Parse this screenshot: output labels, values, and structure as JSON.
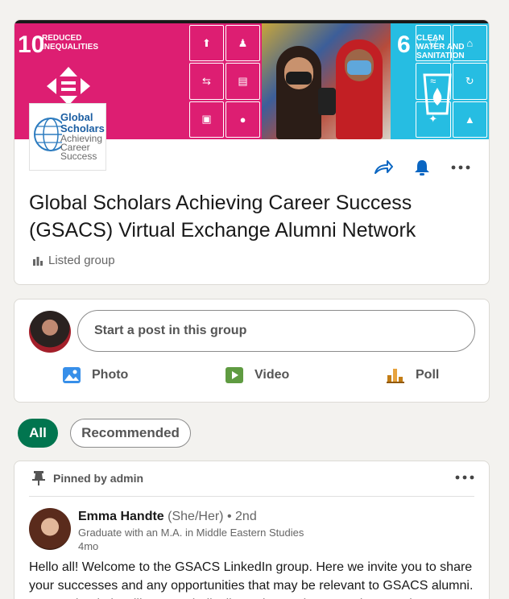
{
  "banner": {
    "sdg10_number": "10",
    "sdg10_text": "REDUCED INEQUALITIES",
    "sdg6_number": "6",
    "sdg6_text": "CLEAN WATER AND SANITATION"
  },
  "logo": {
    "line1": "Global",
    "line2": "Scholars",
    "line3": "Achieving",
    "line4": "Career",
    "line5": "Success"
  },
  "group": {
    "title": "Global Scholars Achieving Career Success (GSACS) Virtual Exchange Alumni Network",
    "visibility": "Listed group",
    "icons": [
      "share-icon",
      "bell-icon",
      "more-icon"
    ]
  },
  "composer": {
    "placeholder": "Start a post in this group",
    "photo_label": "Photo",
    "video_label": "Video",
    "poll_label": "Poll"
  },
  "filters": {
    "all_label": "All",
    "recommended_label": "Recommended"
  },
  "post": {
    "pinned_label": "Pinned by admin",
    "author_name": "Emma Handte",
    "author_pronouns": "(She/Her)",
    "author_degree": "• 2nd",
    "author_headline": "Graduate with an M.A. in Middle Eastern Studies",
    "time": "4mo",
    "body": "Hello all! Welcome to the GSACS LinkedIn group. Here we invite you to share your successes and any opportunities that may be relevant to GSACS alumni. Our geek admin will post periodically to share relevant updates and"
  },
  "colors": {
    "accent_blue": "#0a66c2",
    "accent_green": "#01754f",
    "sdg10": "#dd1e72",
    "sdg6": "#26bde2"
  }
}
